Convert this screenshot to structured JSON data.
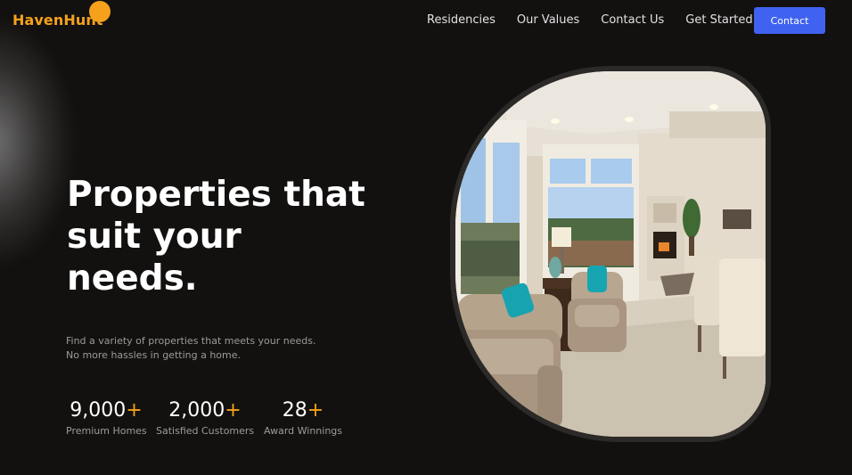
{
  "brand": {
    "name": "HavenHunt"
  },
  "nav": {
    "items": [
      "Residencies",
      "Our Values",
      "Contact Us",
      "Get Started"
    ],
    "cta_label": "Contact"
  },
  "hero": {
    "title": "Properties that suit your needs.",
    "subtitle_line1": "Find a variety of properties that meets your needs.",
    "subtitle_line2": "No more hassles in getting a home.",
    "stats": [
      {
        "value": "9,000",
        "suffix": "+",
        "label": "Premium Homes"
      },
      {
        "value": "2,000",
        "suffix": "+",
        "label": "Satisfied Customers"
      },
      {
        "value": "28",
        "suffix": "+",
        "label": "Award Winnings"
      }
    ]
  },
  "colors": {
    "background": "#131110",
    "accent": "#f5a11c",
    "button": "#4062f0",
    "muted_text": "#9b9b9b"
  }
}
